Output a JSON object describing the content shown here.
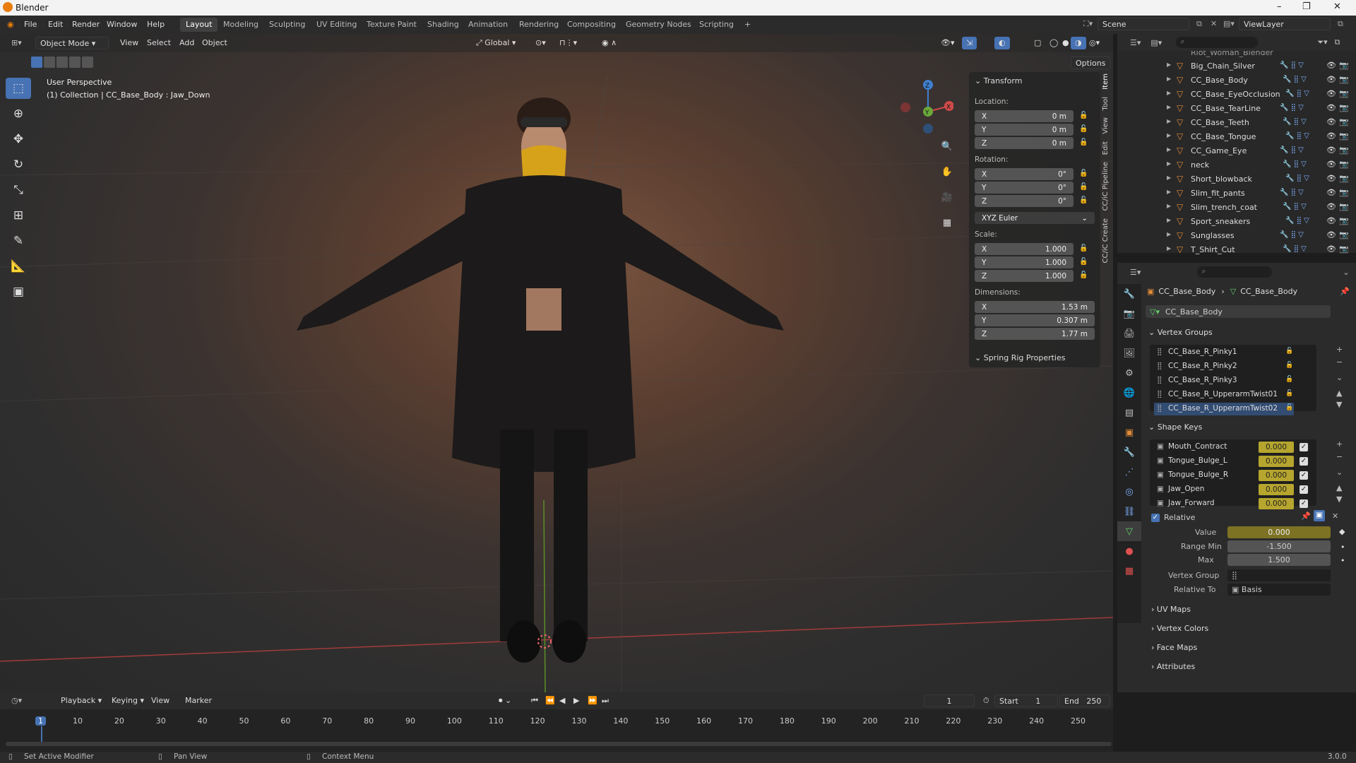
{
  "app": {
    "title": "Blender",
    "version": "3.0.0"
  },
  "window_controls": {
    "minimize": "–",
    "maximize": "❐",
    "close": "✕"
  },
  "menu": [
    "File",
    "Edit",
    "Render",
    "Window",
    "Help"
  ],
  "workspaces": [
    {
      "label": "Layout",
      "active": true
    },
    {
      "label": "Modeling"
    },
    {
      "label": "Sculpting"
    },
    {
      "label": "UV Editing"
    },
    {
      "label": "Texture Paint"
    },
    {
      "label": "Shading"
    },
    {
      "label": "Animation"
    },
    {
      "label": "Rendering"
    },
    {
      "label": "Compositing"
    },
    {
      "label": "Geometry Nodes"
    },
    {
      "label": "Scripting"
    }
  ],
  "add_workspace": "+",
  "scene": {
    "label": "Scene",
    "view_layer": "ViewLayer"
  },
  "viewport_header": {
    "mode": "Object Mode",
    "menus": [
      "View",
      "Select",
      "Add",
      "Object"
    ],
    "orientation": "Global",
    "options": "Options"
  },
  "viewport_info": {
    "perspective": "User Perspective",
    "collection": "(1) Collection | CC_Base_Body : Jaw_Down"
  },
  "gizmo": {
    "x": "X",
    "y": "Y",
    "z": "Z"
  },
  "n_panel": {
    "tabs": [
      "Item",
      "Tool",
      "View",
      "Edit",
      "CC/iC Pipeline",
      "CC/iC Create"
    ],
    "transform_title": "Transform",
    "location_label": "Location:",
    "location": [
      {
        "axis": "X",
        "value": "0 m"
      },
      {
        "axis": "Y",
        "value": "0 m"
      },
      {
        "axis": "Z",
        "value": "0 m"
      }
    ],
    "rotation_label": "Rotation:",
    "rotation": [
      {
        "axis": "X",
        "value": "0°"
      },
      {
        "axis": "Y",
        "value": "0°"
      },
      {
        "axis": "Z",
        "value": "0°"
      }
    ],
    "rotation_mode": "XYZ Euler",
    "scale_label": "Scale:",
    "scale": [
      {
        "axis": "X",
        "value": "1.000"
      },
      {
        "axis": "Y",
        "value": "1.000"
      },
      {
        "axis": "Z",
        "value": "1.000"
      }
    ],
    "dimensions_label": "Dimensions:",
    "dimensions": [
      {
        "axis": "X",
        "value": "1.53 m"
      },
      {
        "axis": "Y",
        "value": "0.307 m"
      },
      {
        "axis": "Z",
        "value": "1.77 m"
      }
    ],
    "spring_rig": "Spring Rig Properties"
  },
  "outliner": {
    "cut_item": "Rlot_Woman_Blender",
    "items": [
      "Big_Chain_Silver",
      "CC_Base_Body",
      "CC_Base_EyeOcclusion",
      "CC_Base_TearLine",
      "CC_Base_Teeth",
      "CC_Base_Tongue",
      "CC_Game_Eye",
      "neck",
      "Short_blowback",
      "Slim_fit_pants",
      "Slim_trench_coat",
      "Sport_sneakers",
      "Sunglasses",
      "T_Shirt_Cut"
    ]
  },
  "properties": {
    "breadcrumb_object": "CC_Base_Body",
    "breadcrumb_mesh": "CC_Base_Body",
    "mesh_name": "CC_Base_Body",
    "vertex_groups_title": "Vertex Groups",
    "vertex_groups": [
      "CC_Base_R_Pinky1",
      "CC_Base_R_Pinky2",
      "CC_Base_R_Pinky3",
      "CC_Base_R_UpperarmTwist01",
      "CC_Base_R_UpperarmTwist02"
    ],
    "shape_keys_title": "Shape Keys",
    "shape_keys": [
      {
        "name": "Mouth_Contract",
        "value": "0.000"
      },
      {
        "name": "Tongue_Bulge_L",
        "value": "0.000"
      },
      {
        "name": "Tongue_Bulge_R",
        "value": "0.000"
      },
      {
        "name": "Jaw_Open",
        "value": "0.000"
      },
      {
        "name": "Jaw_Forward",
        "value": "0.000"
      }
    ],
    "relative_label": "Relative",
    "value_label": "Value",
    "value": "0.000",
    "range_min_label": "Range Min",
    "range_min": "-1.500",
    "max_label": "Max",
    "max": "1.500",
    "vertex_group_label": "Vertex Group",
    "relative_to_label": "Relative To",
    "relative_to": "Basis",
    "collapsed_sections": [
      "UV Maps",
      "Vertex Colors",
      "Face Maps",
      "Attributes"
    ]
  },
  "timeline": {
    "menus": [
      "Playback",
      "Keying",
      "View",
      "Marker"
    ],
    "current_frame": "1",
    "start_label": "Start",
    "start": "1",
    "end_label": "End",
    "end": "250",
    "ticks": [
      "1",
      "10",
      "20",
      "30",
      "40",
      "50",
      "60",
      "70",
      "80",
      "90",
      "100",
      "110",
      "120",
      "130",
      "140",
      "150",
      "160",
      "170",
      "180",
      "190",
      "200",
      "210",
      "220",
      "230",
      "240",
      "250"
    ]
  },
  "status_bar": {
    "left": "Set Active Modifier",
    "middle": "Pan View",
    "right": "Context Menu"
  }
}
